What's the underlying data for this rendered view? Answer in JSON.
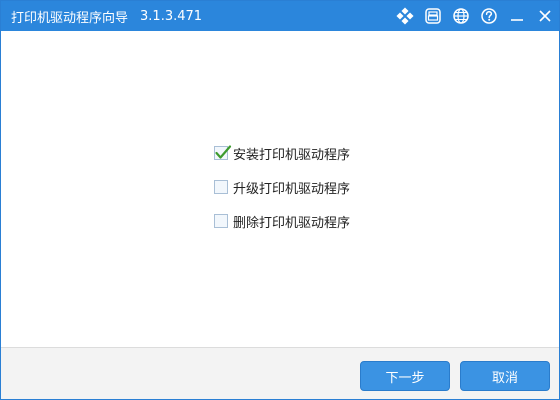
{
  "window": {
    "title": "打印机驱动程序向导",
    "version": "3.1.3.471",
    "controls": [
      "feature-icon",
      "printer-icon",
      "globe-icon",
      "help-icon",
      "minimize-icon",
      "close-icon"
    ]
  },
  "options": [
    {
      "label": "安装打印机驱动程序",
      "checked": true
    },
    {
      "label": "升级打印机驱动程序",
      "checked": false
    },
    {
      "label": "删除打印机驱动程序",
      "checked": false
    }
  ],
  "footer": {
    "next_label": "下一步",
    "cancel_label": "取消"
  },
  "colors": {
    "titlebar": "#2b86dc",
    "button": "#3b93e3",
    "check": "#3d9b2e"
  }
}
